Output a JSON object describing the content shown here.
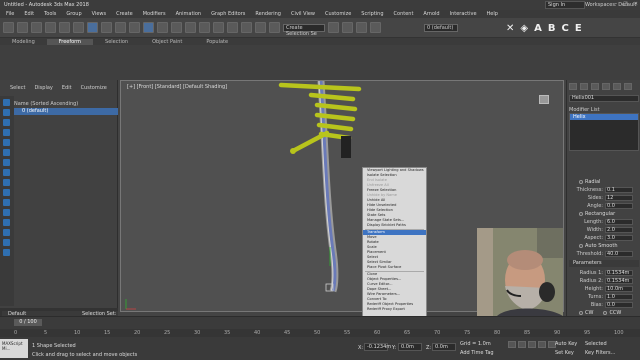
{
  "window": {
    "title": "Untitled - Autodesk 3ds Max 2018",
    "signin_label": "Sign In",
    "workspace_label": "Workspaces: Default"
  },
  "menu": [
    "File",
    "Edit",
    "Tools",
    "Group",
    "Views",
    "Create",
    "Modifiers",
    "Animation",
    "Graph Editors",
    "Rendering",
    "Civil View",
    "Customize",
    "Scripting",
    "Content",
    "Arnold",
    "Interactive",
    "Help"
  ],
  "toolbar": {
    "selection_set_placeholder": "Create Selection Se",
    "layer_label": "0 (default)",
    "big_icons": [
      "✕",
      "◈",
      "A",
      "B",
      "C",
      "E"
    ]
  },
  "ribbon": {
    "tabs": [
      "Modeling",
      "Freeform",
      "Selection",
      "Object Paint",
      "Populate"
    ],
    "active_index": 1
  },
  "scene_explorer": {
    "tabs": [
      "Select",
      "Display",
      "Edit",
      "Customize"
    ],
    "header": "Name (Sorted Ascending)",
    "rows": [
      "0 (default)"
    ]
  },
  "viewport": {
    "label": "[+] [Front] [Standard] [Default Shading]"
  },
  "context_menu": {
    "items": [
      {
        "label": "Viewport Lighting and Shadows",
        "dim": false
      },
      {
        "label": "Isolate Selection",
        "dim": false
      },
      {
        "label": "End Isolate",
        "dim": true
      },
      {
        "label": "Unfreeze All",
        "dim": true
      },
      {
        "label": "Freeze Selection",
        "dim": false
      },
      {
        "label": "Unhide by Name",
        "dim": true
      },
      {
        "label": "Unhide All",
        "dim": false
      },
      {
        "label": "Hide Unselected",
        "dim": false
      },
      {
        "label": "Hide Selection",
        "dim": false
      },
      {
        "label": "State Sets",
        "dim": false
      },
      {
        "label": "Manage State Sets...",
        "dim": false
      },
      {
        "label": "Display Bricklet Paths",
        "dim": false
      },
      {
        "label": "Transform",
        "dim": false
      },
      {
        "label": "Move",
        "dim": false
      },
      {
        "label": "Rotate",
        "dim": false
      },
      {
        "label": "Scale",
        "dim": false
      },
      {
        "label": "Placement",
        "dim": false
      },
      {
        "label": "Select",
        "dim": false
      },
      {
        "label": "Select Similar",
        "dim": false
      },
      {
        "label": "Place Pivot Surface",
        "dim": false
      },
      {
        "label": "Clone",
        "dim": false
      },
      {
        "label": "Object Properties...",
        "dim": false
      },
      {
        "label": "Curve Editor...",
        "dim": false
      },
      {
        "label": "Dope Sheet...",
        "dim": false
      },
      {
        "label": "Wire Parameters...",
        "dim": false
      },
      {
        "label": "Convert To:",
        "dim": false
      },
      {
        "label": "Rederiff Object Properties",
        "dim": false
      },
      {
        "label": "Rederiff Proxy Export",
        "dim": false
      }
    ],
    "highlighted_index": 12
  },
  "command_panel": {
    "object_name": "Helix001",
    "modifier_list_label": "Modifier List",
    "stack": [
      "Helix"
    ],
    "rendering_label": "Rendering",
    "interpolation": {
      "radial_label": "Radial",
      "thickness_label": "Thickness:",
      "thickness": "0.1",
      "sides_label": "Sides:",
      "sides": "12",
      "angle_label": "Angle:",
      "angle": "0.0",
      "rect_label": "Rectangular",
      "length_label": "Length:",
      "length": "6.0",
      "width_label": "Width:",
      "width": "2.0",
      "aspect_label": "Aspect:",
      "aspect": "3.0",
      "auto_smooth_label": "Auto Smooth",
      "threshold_label": "Threshold:",
      "threshold": "40.0"
    },
    "parameters_label": "Parameters",
    "params": [
      {
        "label": "Radius 1:",
        "value": "0.1534m"
      },
      {
        "label": "Radius 2:",
        "value": "0.1534m"
      },
      {
        "label": "Height:",
        "value": "10.0m"
      },
      {
        "label": "Turns:",
        "value": "1.0"
      },
      {
        "label": "Bias:",
        "value": "0.0"
      }
    ],
    "cw_label": "CW",
    "ccw_label": "CCW"
  },
  "timeline": {
    "slider_label": "0 / 100",
    "ticks": [
      "0",
      "5",
      "10",
      "15",
      "20",
      "25",
      "30",
      "35",
      "40",
      "45",
      "50",
      "55",
      "60",
      "65",
      "70",
      "75",
      "80",
      "85",
      "90",
      "95",
      "100"
    ]
  },
  "status": {
    "maxscript_label": "MAXScript Mi...",
    "line1": "1 Shape Selected",
    "line2": "Click and drag to select and move objects",
    "x_label": "X:",
    "x_value": "-0.1234m",
    "y_label": "Y:",
    "y_value": "0.0m",
    "z_label": "Z:",
    "z_value": "0.0m",
    "grid_label": "Grid = 1.0m",
    "add_time_tag": "Add Time Tag",
    "auto_key": "Auto Key",
    "set_key": "Set Key",
    "selected_label": "Selected",
    "key_filters": "Key Filters..."
  },
  "bottom_left": {
    "layer_label": "Default",
    "selection_set_label": "Selection Set:"
  },
  "colors": {
    "accent": "#3e74c2",
    "helix": "#b8c41c",
    "viewport_bg": "#505050"
  }
}
